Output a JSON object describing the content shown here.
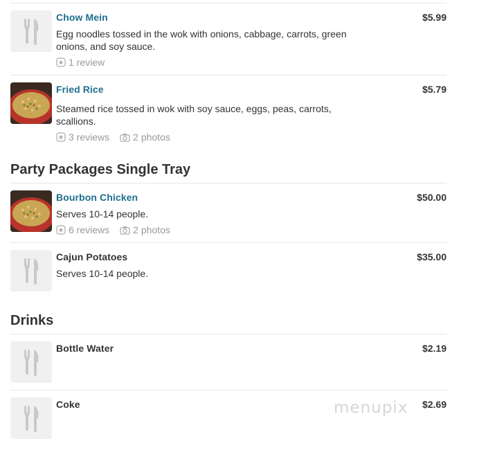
{
  "sections": [
    {
      "title": "",
      "items": [
        {
          "name": "Chow Mein",
          "price": "$5.99",
          "desc": "Egg noodles tossed in the wok with onions, cabbage, carrots, green onions, and soy sauce.",
          "reviews": "1 review",
          "photos": "",
          "image": "placeholder-utensils-icon"
        },
        {
          "name": "Fried Rice",
          "price": "$5.79",
          "desc": "Steamed rice tossed in wok with soy sauce, eggs, peas, carrots, scallions.",
          "reviews": "3 reviews",
          "photos": "2 photos",
          "image": "food-photo"
        }
      ]
    },
    {
      "title": "Party Packages Single Tray",
      "items": [
        {
          "name": "Bourbon Chicken",
          "price": "$50.00",
          "desc": "Serves 10-14 people.",
          "reviews": "6 reviews",
          "photos": "2 photos",
          "image": "food-photo"
        },
        {
          "name": "Cajun Potatoes",
          "price": "$35.00",
          "desc": "Serves 10-14 people.",
          "reviews": "",
          "photos": "",
          "image": "placeholder-utensils-icon"
        }
      ]
    },
    {
      "title": "Drinks",
      "items": [
        {
          "name": "Bottle Water",
          "price": "$2.19",
          "desc": "",
          "reviews": "",
          "photos": "",
          "image": "placeholder-utensils-icon"
        },
        {
          "name": "Coke",
          "price": "$2.69",
          "desc": "",
          "reviews": "",
          "photos": "",
          "image": "placeholder-utensils-icon"
        }
      ]
    }
  ],
  "watermark": "menupix",
  "colors": {
    "link": "#1e6e8e",
    "text": "#333333",
    "meta": "#999999",
    "divider": "#e6e6e6"
  }
}
